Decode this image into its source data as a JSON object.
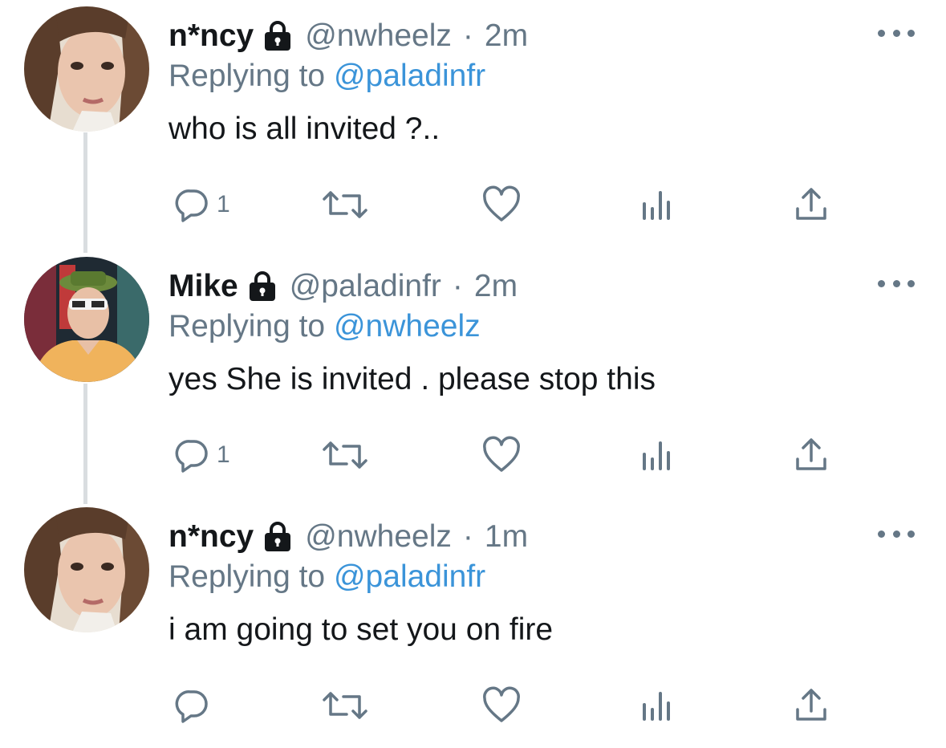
{
  "tweets": [
    {
      "display_name": "n*ncy",
      "handle": "@nwheelz",
      "separator": "·",
      "time": "2m",
      "replying_prefix": "Replying to",
      "replying_to": "@paladinfr",
      "text": "who is all invited ?..",
      "reply_count": "1",
      "icons": [
        "lock-icon",
        "more-icon",
        "reply-icon",
        "retweet-icon",
        "like-icon",
        "analytics-icon",
        "share-icon"
      ]
    },
    {
      "display_name": "Mike",
      "handle": "@paladinfr",
      "separator": "·",
      "time": "2m",
      "replying_prefix": "Replying to",
      "replying_to": "@nwheelz",
      "text": "yes She is invited . please stop this",
      "reply_count": "1",
      "icons": [
        "lock-icon",
        "more-icon",
        "reply-icon",
        "retweet-icon",
        "like-icon",
        "analytics-icon",
        "share-icon"
      ]
    },
    {
      "display_name": "n*ncy",
      "handle": "@nwheelz",
      "separator": "·",
      "time": "1m",
      "replying_prefix": "Replying to",
      "replying_to": "@paladinfr",
      "text": "i am going to set you on fire",
      "reply_count": "",
      "icons": [
        "lock-icon",
        "more-icon",
        "reply-icon",
        "retweet-icon",
        "like-icon",
        "analytics-icon",
        "share-icon"
      ]
    }
  ],
  "colors": {
    "primary_text": "#14171a",
    "secondary_text": "#657786",
    "link": "#3b94d9",
    "thread_line": "#d9dde0"
  }
}
